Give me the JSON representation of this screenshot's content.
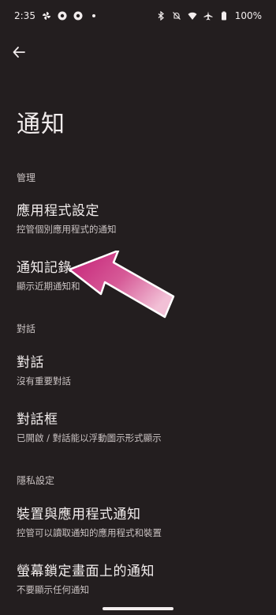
{
  "status_bar": {
    "time": "2:35",
    "battery": "100%",
    "left_icons": [
      "pinwheel-icon",
      "chrome-icon",
      "chrome-icon",
      "dot-icon"
    ],
    "right_icons": [
      "bluetooth-icon",
      "bell-off-icon",
      "wifi-icon",
      "airplane-icon",
      "battery-icon"
    ]
  },
  "header": {
    "back_icon": "arrow-left-icon",
    "title": "通知"
  },
  "sections": {
    "manage": "管理",
    "conversations": "對話",
    "privacy": "隱私設定"
  },
  "items": {
    "app_settings": {
      "title": "應用程式設定",
      "subtitle": "控管個別應用程式的通知"
    },
    "history": {
      "title": "通知記錄",
      "subtitle": "顯示近期通知和"
    },
    "conversations": {
      "title": "對話",
      "subtitle": "沒有重要對話"
    },
    "bubbles": {
      "title": "對話框",
      "subtitle": "已開啟 / 對話能以浮動圖示形式顯示"
    },
    "device_app": {
      "title": "裝置與應用程式通知",
      "subtitle": "控管可以讀取通知的應用程式和裝置"
    },
    "lock_screen": {
      "title": "螢幕鎖定畫面上的通知",
      "subtitle": "不要顯示任何通知"
    }
  },
  "colors": {
    "background": "#231e1f",
    "text_primary": "#f2eded",
    "text_secondary": "#c9c2c2",
    "arrow_start": "#c51f76",
    "arrow_end": "#f5b9d2"
  }
}
